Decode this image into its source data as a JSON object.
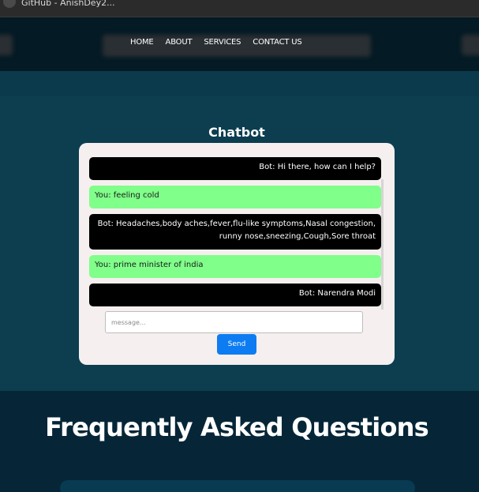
{
  "browser": {
    "tab_title": "GitHub - AnishDey2..."
  },
  "nav": {
    "links": [
      "HOME",
      "ABOUT",
      "SERVICES",
      "CONTACT US"
    ]
  },
  "chat": {
    "heading": "Chatbot",
    "messages": [
      {
        "sender": "bot",
        "text": "Bot: Hi there, how can I help?"
      },
      {
        "sender": "you",
        "text": "You: feeling cold"
      },
      {
        "sender": "bot",
        "text": "Bot: Headaches,body aches,fever,flu-like symptoms,Nasal congestion, runny nose,sneezing,Cough,Sore throat"
      },
      {
        "sender": "you",
        "text": "You: prime minister of india"
      },
      {
        "sender": "bot",
        "text": "Bot: Narendra Modi"
      }
    ],
    "input": {
      "value": "",
      "placeholder": "message..."
    },
    "send_label": "Send"
  },
  "faq": {
    "heading": "Frequently Asked Questions"
  },
  "colors": {
    "bot_bubble": "#000000",
    "user_bubble": "#80ff8a",
    "send_button": "#0d7cf2",
    "page_bg": "#0c3e50"
  }
}
